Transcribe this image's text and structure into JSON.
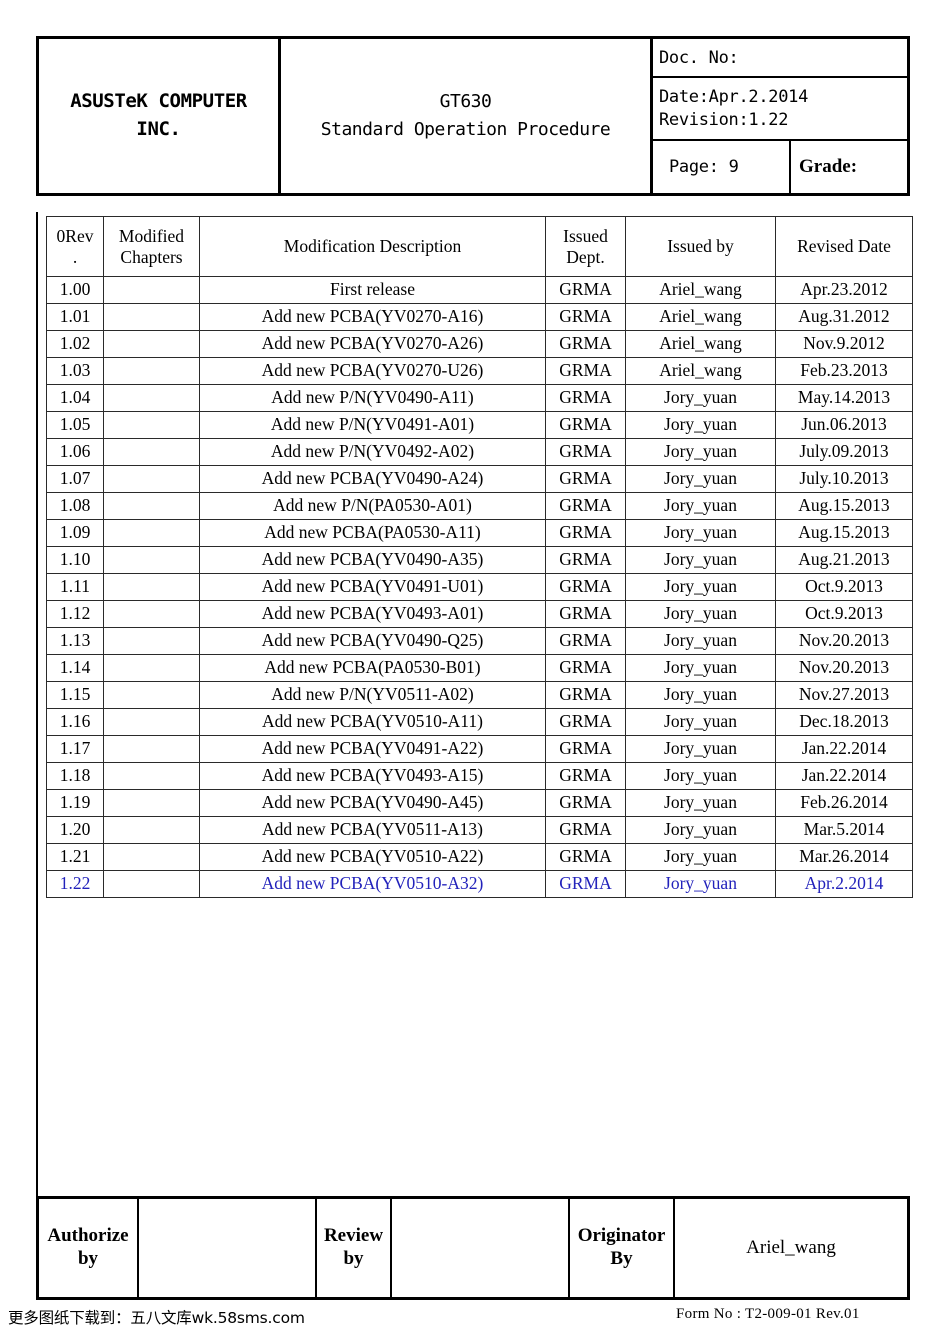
{
  "header": {
    "company_line1": "ASUSTeK COMPUTER",
    "company_line2": "INC.",
    "title_line1": "GT630",
    "title_line2": "Standard Operation Procedure",
    "doc_no_label": "Doc. No:",
    "date_label": "Date:Apr.2.2014",
    "revision_label": "Revision:1.22",
    "page_label": "Page: 9",
    "grade_label": "Grade:"
  },
  "revision_table": {
    "columns": [
      "0Rev.",
      "Modified Chapters",
      "Modification Description",
      "Issued Dept.",
      "Issued by",
      "Revised Date"
    ],
    "col_rev_line1": "0Rev",
    "col_rev_line2": ".",
    "col_chapters_line1": "Modified",
    "col_chapters_line2": "Chapters",
    "col_description": "Modification Description",
    "col_dept_line1": "Issued",
    "col_dept_line2": "Dept.",
    "col_issued_by": "Issued by",
    "col_revised_date": "Revised Date",
    "highlight_color": "#2222bb",
    "rows": [
      {
        "rev": "1.00",
        "chapters": "",
        "description": "First release",
        "dept": "GRMA",
        "issued_by": "Ariel_wang",
        "date": "Apr.23.2012",
        "highlight": false
      },
      {
        "rev": "1.01",
        "chapters": "",
        "description": "Add new PCBA(YV0270-A16)",
        "dept": "GRMA",
        "issued_by": "Ariel_wang",
        "date": "Aug.31.2012",
        "highlight": false
      },
      {
        "rev": "1.02",
        "chapters": "",
        "description": "Add new PCBA(YV0270-A26)",
        "dept": "GRMA",
        "issued_by": "Ariel_wang",
        "date": "Nov.9.2012",
        "highlight": false
      },
      {
        "rev": "1.03",
        "chapters": "",
        "description": "Add new PCBA(YV0270-U26)",
        "dept": "GRMA",
        "issued_by": "Ariel_wang",
        "date": "Feb.23.2013",
        "highlight": false
      },
      {
        "rev": "1.04",
        "chapters": "",
        "description": "Add new P/N(YV0490-A11)",
        "dept": "GRMA",
        "issued_by": "Jory_yuan",
        "date": "May.14.2013",
        "highlight": false
      },
      {
        "rev": "1.05",
        "chapters": "",
        "description": "Add new P/N(YV0491-A01)",
        "dept": "GRMA",
        "issued_by": "Jory_yuan",
        "date": "Jun.06.2013",
        "highlight": false
      },
      {
        "rev": "1.06",
        "chapters": "",
        "description": "Add new P/N(YV0492-A02)",
        "dept": "GRMA",
        "issued_by": "Jory_yuan",
        "date": "July.09.2013",
        "highlight": false
      },
      {
        "rev": "1.07",
        "chapters": "",
        "description": "Add new PCBA(YV0490-A24)",
        "dept": "GRMA",
        "issued_by": "Jory_yuan",
        "date": "July.10.2013",
        "highlight": false
      },
      {
        "rev": "1.08",
        "chapters": "",
        "description": "Add new P/N(PA0530-A01)",
        "dept": "GRMA",
        "issued_by": "Jory_yuan",
        "date": "Aug.15.2013",
        "highlight": false
      },
      {
        "rev": "1.09",
        "chapters": "",
        "description": "Add new PCBA(PA0530-A11)",
        "dept": "GRMA",
        "issued_by": "Jory_yuan",
        "date": "Aug.15.2013",
        "highlight": false
      },
      {
        "rev": "1.10",
        "chapters": "",
        "description": "Add new PCBA(YV0490-A35)",
        "dept": "GRMA",
        "issued_by": "Jory_yuan",
        "date": "Aug.21.2013",
        "highlight": false
      },
      {
        "rev": "1.11",
        "chapters": "",
        "description": "Add new PCBA(YV0491-U01)",
        "dept": "GRMA",
        "issued_by": "Jory_yuan",
        "date": "Oct.9.2013",
        "highlight": false
      },
      {
        "rev": "1.12",
        "chapters": "",
        "description": "Add new PCBA(YV0493-A01)",
        "dept": "GRMA",
        "issued_by": "Jory_yuan",
        "date": "Oct.9.2013",
        "highlight": false
      },
      {
        "rev": "1.13",
        "chapters": "",
        "description": "Add new PCBA(YV0490-Q25)",
        "dept": "GRMA",
        "issued_by": "Jory_yuan",
        "date": "Nov.20.2013",
        "highlight": false
      },
      {
        "rev": "1.14",
        "chapters": "",
        "description": "Add new PCBA(PA0530-B01)",
        "dept": "GRMA",
        "issued_by": "Jory_yuan",
        "date": "Nov.20.2013",
        "highlight": false
      },
      {
        "rev": "1.15",
        "chapters": "",
        "description": "Add new P/N(YV0511-A02)",
        "dept": "GRMA",
        "issued_by": "Jory_yuan",
        "date": "Nov.27.2013",
        "highlight": false
      },
      {
        "rev": "1.16",
        "chapters": "",
        "description": "Add new PCBA(YV0510-A11)",
        "dept": "GRMA",
        "issued_by": "Jory_yuan",
        "date": "Dec.18.2013",
        "highlight": false
      },
      {
        "rev": "1.17",
        "chapters": "",
        "description": "Add new PCBA(YV0491-A22)",
        "dept": "GRMA",
        "issued_by": "Jory_yuan",
        "date": "Jan.22.2014",
        "highlight": false
      },
      {
        "rev": "1.18",
        "chapters": "",
        "description": "Add new PCBA(YV0493-A15)",
        "dept": "GRMA",
        "issued_by": "Jory_yuan",
        "date": "Jan.22.2014",
        "highlight": false
      },
      {
        "rev": "1.19",
        "chapters": "",
        "description": "Add new PCBA(YV0490-A45)",
        "dept": "GRMA",
        "issued_by": "Jory_yuan",
        "date": "Feb.26.2014",
        "highlight": false
      },
      {
        "rev": "1.20",
        "chapters": "",
        "description": "Add new PCBA(YV0511-A13)",
        "dept": "GRMA",
        "issued_by": "Jory_yuan",
        "date": "Mar.5.2014",
        "highlight": false
      },
      {
        "rev": "1.21",
        "chapters": "",
        "description": "Add new PCBA(YV0510-A22)",
        "dept": "GRMA",
        "issued_by": "Jory_yuan",
        "date": "Mar.26.2014",
        "highlight": false
      },
      {
        "rev": "1.22",
        "chapters": "",
        "description": "Add new PCBA(YV0510-A32)",
        "dept": "GRMA",
        "issued_by": "Jory_yuan",
        "date": "Apr.2.2014",
        "highlight": true
      }
    ]
  },
  "signoff": {
    "authorize_line1": "Authorize",
    "authorize_line2": "by",
    "authorize_value": "",
    "review_line1": "Review",
    "review_line2": "by",
    "review_value": "",
    "originator_line1": "Originator",
    "originator_line2": "By",
    "originator_value": "Ariel_wang"
  },
  "footer": {
    "watermark": "更多图纸下载到：五八文库wk.58sms.com",
    "form_no": "Form No : T2-009-01  Rev.01"
  }
}
